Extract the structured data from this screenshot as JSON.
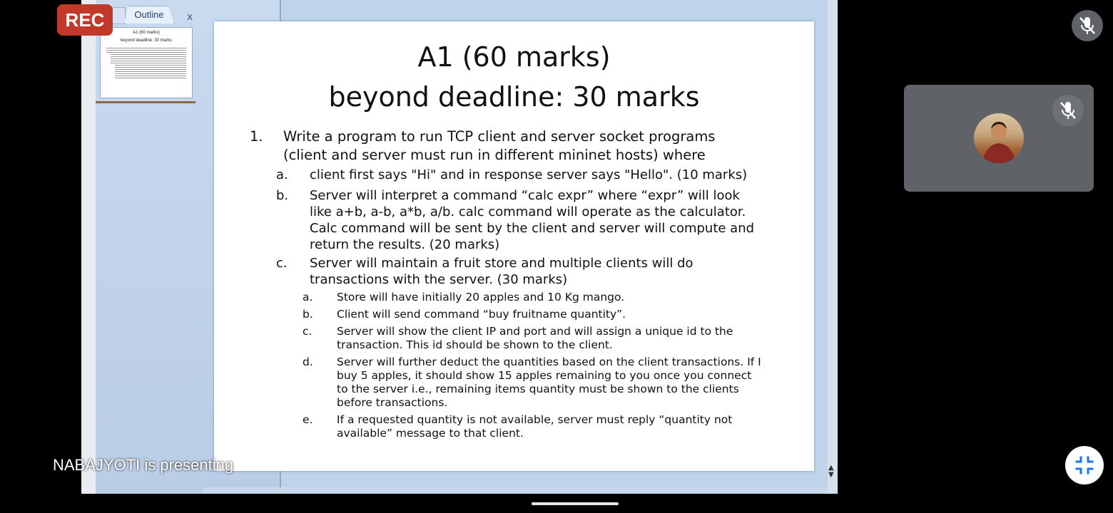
{
  "meeting": {
    "rec_label": "REC",
    "presenting_text": "NABAJYOTI is presenting"
  },
  "ppt": {
    "outline_tab_label": "Outline",
    "close_label": "x",
    "thumb_title_1": "A1 (60 marks)",
    "thumb_title_2": "beyond deadline: 30 marks"
  },
  "slide": {
    "title_line1": "A1 (60 marks)",
    "title_line2": "beyond deadline: 30 marks",
    "item1": {
      "num": "1.",
      "lines": [
        "Write a program to run TCP client and server socket programs",
        "(client and server must run in different mininet hosts) where"
      ]
    },
    "sub_a": {
      "num": "a.",
      "lines": [
        "client first says \"Hi\" and in response server says \"Hello\". (10 marks)"
      ]
    },
    "sub_b": {
      "num": "b.",
      "lines": [
        "Server will interpret a command “calc expr” where “expr” will look",
        "like a+b, a-b, a*b, a/b. calc command will operate as the calculator.",
        "Calc command will be sent by the client and server will compute and",
        "return the results. (20 marks)"
      ]
    },
    "sub_c": {
      "num": "c.",
      "lines": [
        "Server will maintain a fruit store and multiple clients will do",
        "transactions with the server.  (30 marks)"
      ]
    },
    "ssub_a": {
      "num": "a.",
      "lines": [
        "Store will have initially 20 apples and 10 Kg mango."
      ]
    },
    "ssub_b": {
      "num": "b.",
      "lines": [
        "Client will send command “buy fruitname quantity”."
      ]
    },
    "ssub_c": {
      "num": "c.",
      "lines": [
        "Server will show the client IP and port and will assign a unique id to the",
        "transaction. This id should be shown to the client."
      ]
    },
    "ssub_d": {
      "num": "d.",
      "lines": [
        "Server will further deduct the quantities based on the client transactions. If I",
        "buy 5 apples, it should show 15 apples remaining to you once you connect",
        "to the server i.e., remaining items quantity must be shown to the clients",
        "before transactions."
      ]
    },
    "ssub_e": {
      "num": "e.",
      "lines": [
        "If a requested quantity is not available, server must reply “quantity not",
        "available” message to that client."
      ]
    }
  },
  "colors": {
    "rec": "#c0392b",
    "tile": "#5f6368",
    "ppt_panel": "#c9daef"
  },
  "icons": [
    "mic-off-icon",
    "exit-fullscreen-icon",
    "close-icon",
    "scroll-arrow-icon"
  ]
}
